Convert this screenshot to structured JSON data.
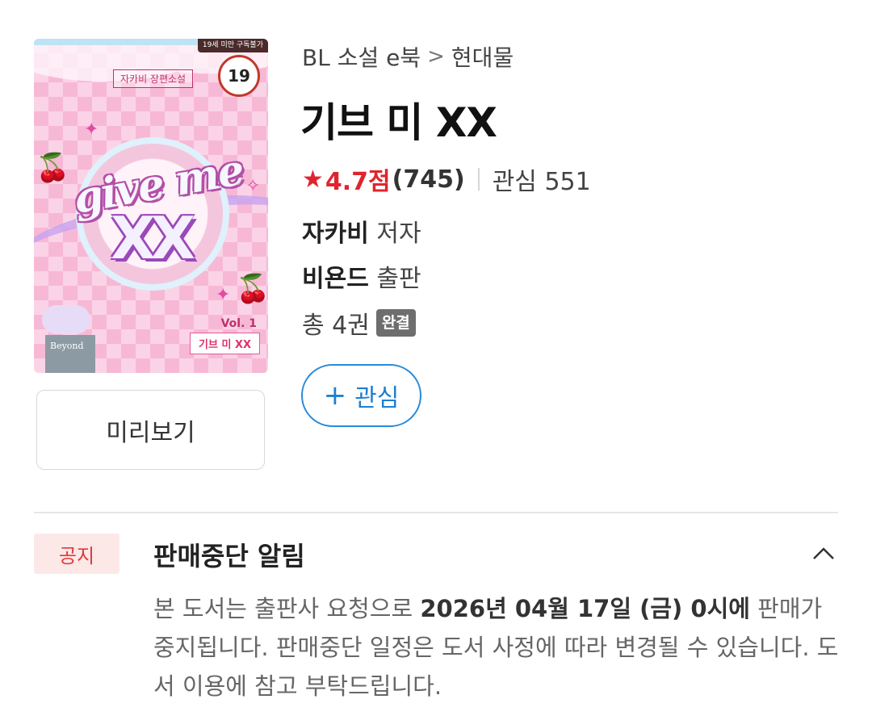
{
  "breadcrumb": {
    "category": "BL 소설 e북",
    "separator": ">",
    "subcategory": "현대물"
  },
  "book": {
    "title": "기브 미 XX"
  },
  "rating": {
    "score": "4.7점",
    "count": "(745)",
    "interest_label": "관심 551"
  },
  "author": {
    "name": "자카비",
    "role": "저자"
  },
  "publisher": {
    "name": "비욘드",
    "role": "출판"
  },
  "volumes": {
    "text": "총 4권",
    "badge": "완결"
  },
  "buttons": {
    "preview": "미리보기",
    "interest_plus": "+",
    "interest": "관심"
  },
  "cover": {
    "age_notice": "19세 미만 구독불가",
    "age_badge": "19",
    "author_tag": "자카비 장편소설",
    "title_line1": "give me",
    "title_line2": "XX",
    "vol": "Vol. 1",
    "vol_title": "기브 미 XX",
    "publisher_logo": "Beyond"
  },
  "notice": {
    "tag": "공지",
    "title": "판매중단 알림",
    "body_pre": "본 도서는 출판사 요청으로 ",
    "body_date": "2026년 04월 17일 (금) 0시에",
    "body_post": " 판매가 중지됩니다. 판매중단 일정은 도서 사정에 따라 변경될 수 있습니다. 도서 이용에 참고 부탁드립니다."
  },
  "colors": {
    "accent_red": "#e0242e",
    "accent_blue": "#1f7fd1",
    "notice_tag_bg": "#fde8e8"
  }
}
